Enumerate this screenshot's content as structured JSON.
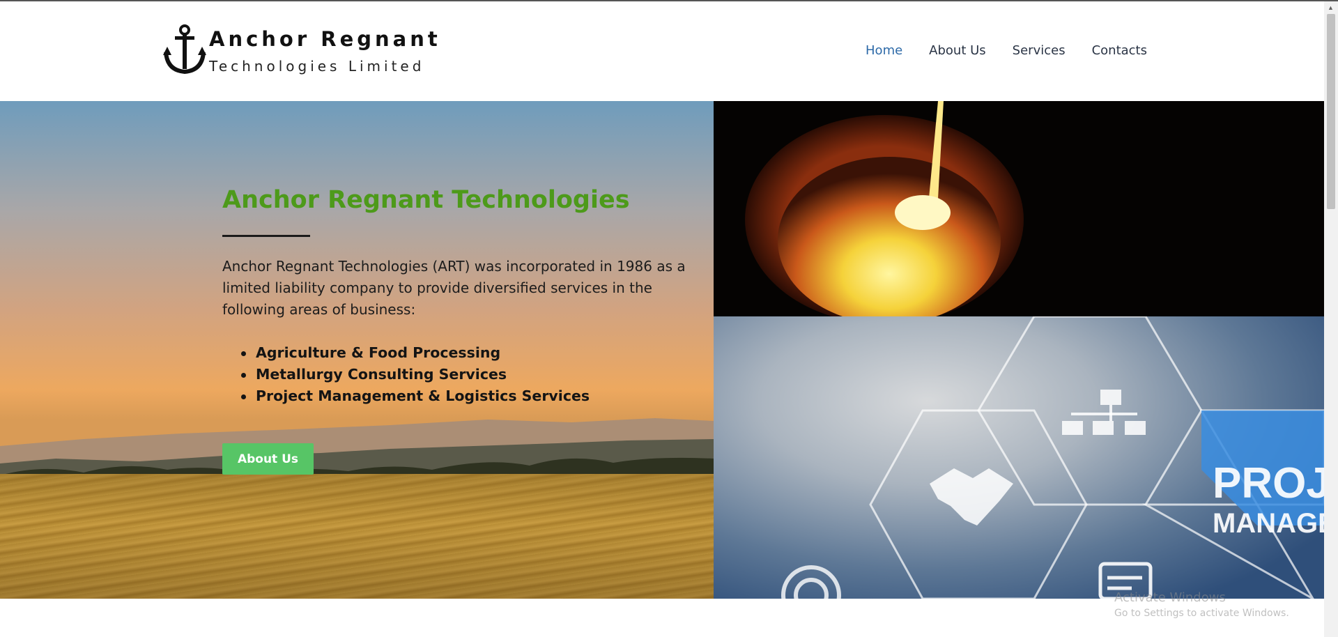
{
  "logo": {
    "line1": "Anchor Regnant",
    "line2": "Technologies Limited"
  },
  "nav": {
    "items": [
      {
        "label": "Home",
        "active": true
      },
      {
        "label": "About Us",
        "active": false
      },
      {
        "label": "Services",
        "active": false
      },
      {
        "label": "Contacts",
        "active": false
      }
    ]
  },
  "hero": {
    "title": "Anchor Regnant Technologies",
    "description": "Anchor Regnant Technologies (ART) was incorporated in 1986 as a limited liability company to provide diversified services in the following areas of business:",
    "services": [
      "Agriculture & Food Processing",
      "Metallurgy Consulting Services",
      "Project Management & Logistics Services"
    ],
    "button_label": "About Us",
    "title_color": "#4d9a1a",
    "button_color": "#57c566"
  },
  "images": {
    "pm_overlay_line1": "PROJE",
    "pm_overlay_line2": "MANAGEM"
  },
  "watermark": {
    "title": "Activate Windows",
    "subtitle": "Go to Settings to activate Windows."
  },
  "colors": {
    "nav_active": "#2d6aa8",
    "nav_default": "#2a3445"
  },
  "icons": [
    "anchor-icon",
    "org-chart-icon",
    "handshake-icon",
    "target-icon",
    "gantt-icon"
  ]
}
